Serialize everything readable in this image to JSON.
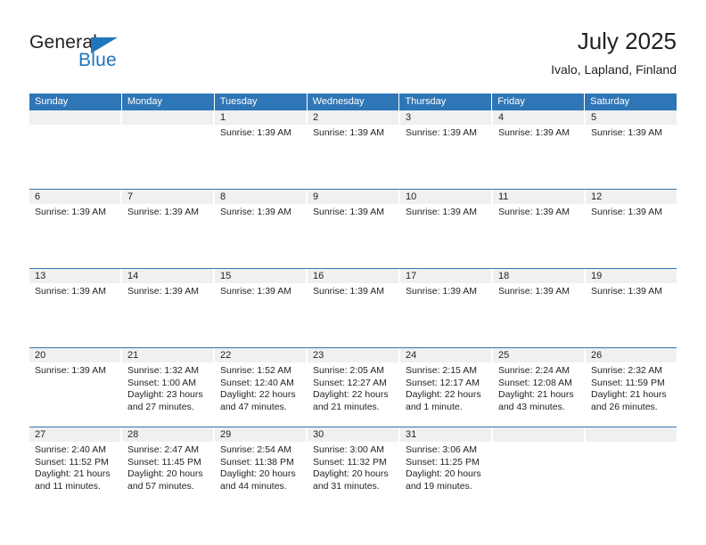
{
  "brand": {
    "name_part1": "General",
    "name_part2": "Blue",
    "triangle_color": "#1f76bc",
    "text_color": "#231f20"
  },
  "header": {
    "title": "July 2025",
    "subtitle": "Ivalo, Lapland, Finland",
    "header_bg": "#2f76b6",
    "daynum_bg": "#f0f0f0"
  },
  "weekdays": [
    "Sunday",
    "Monday",
    "Tuesday",
    "Wednesday",
    "Thursday",
    "Friday",
    "Saturday"
  ],
  "weeks": [
    {
      "days": [
        {
          "num": "",
          "lines": []
        },
        {
          "num": "",
          "lines": []
        },
        {
          "num": "1",
          "lines": [
            "Sunrise: 1:39 AM"
          ]
        },
        {
          "num": "2",
          "lines": [
            "Sunrise: 1:39 AM"
          ]
        },
        {
          "num": "3",
          "lines": [
            "Sunrise: 1:39 AM"
          ]
        },
        {
          "num": "4",
          "lines": [
            "Sunrise: 1:39 AM"
          ]
        },
        {
          "num": "5",
          "lines": [
            "Sunrise: 1:39 AM"
          ]
        }
      ]
    },
    {
      "days": [
        {
          "num": "6",
          "lines": [
            "Sunrise: 1:39 AM"
          ]
        },
        {
          "num": "7",
          "lines": [
            "Sunrise: 1:39 AM"
          ]
        },
        {
          "num": "8",
          "lines": [
            "Sunrise: 1:39 AM"
          ]
        },
        {
          "num": "9",
          "lines": [
            "Sunrise: 1:39 AM"
          ]
        },
        {
          "num": "10",
          "lines": [
            "Sunrise: 1:39 AM"
          ]
        },
        {
          "num": "11",
          "lines": [
            "Sunrise: 1:39 AM"
          ]
        },
        {
          "num": "12",
          "lines": [
            "Sunrise: 1:39 AM"
          ]
        }
      ]
    },
    {
      "days": [
        {
          "num": "13",
          "lines": [
            "Sunrise: 1:39 AM"
          ]
        },
        {
          "num": "14",
          "lines": [
            "Sunrise: 1:39 AM"
          ]
        },
        {
          "num": "15",
          "lines": [
            "Sunrise: 1:39 AM"
          ]
        },
        {
          "num": "16",
          "lines": [
            "Sunrise: 1:39 AM"
          ]
        },
        {
          "num": "17",
          "lines": [
            "Sunrise: 1:39 AM"
          ]
        },
        {
          "num": "18",
          "lines": [
            "Sunrise: 1:39 AM"
          ]
        },
        {
          "num": "19",
          "lines": [
            "Sunrise: 1:39 AM"
          ]
        }
      ]
    },
    {
      "days": [
        {
          "num": "20",
          "lines": [
            "Sunrise: 1:39 AM"
          ]
        },
        {
          "num": "21",
          "lines": [
            "Sunrise: 1:32 AM",
            "Sunset: 1:00 AM",
            "Daylight: 23 hours",
            "and 27 minutes."
          ]
        },
        {
          "num": "22",
          "lines": [
            "Sunrise: 1:52 AM",
            "Sunset: 12:40 AM",
            "Daylight: 22 hours",
            "and 47 minutes."
          ]
        },
        {
          "num": "23",
          "lines": [
            "Sunrise: 2:05 AM",
            "Sunset: 12:27 AM",
            "Daylight: 22 hours",
            "and 21 minutes."
          ]
        },
        {
          "num": "24",
          "lines": [
            "Sunrise: 2:15 AM",
            "Sunset: 12:17 AM",
            "Daylight: 22 hours",
            "and 1 minute."
          ]
        },
        {
          "num": "25",
          "lines": [
            "Sunrise: 2:24 AM",
            "Sunset: 12:08 AM",
            "Daylight: 21 hours",
            "and 43 minutes."
          ]
        },
        {
          "num": "26",
          "lines": [
            "Sunrise: 2:32 AM",
            "Sunset: 11:59 PM",
            "Daylight: 21 hours",
            "and 26 minutes."
          ]
        }
      ]
    },
    {
      "days": [
        {
          "num": "27",
          "lines": [
            "Sunrise: 2:40 AM",
            "Sunset: 11:52 PM",
            "Daylight: 21 hours",
            "and 11 minutes."
          ]
        },
        {
          "num": "28",
          "lines": [
            "Sunrise: 2:47 AM",
            "Sunset: 11:45 PM",
            "Daylight: 20 hours",
            "and 57 minutes."
          ]
        },
        {
          "num": "29",
          "lines": [
            "Sunrise: 2:54 AM",
            "Sunset: 11:38 PM",
            "Daylight: 20 hours",
            "and 44 minutes."
          ]
        },
        {
          "num": "30",
          "lines": [
            "Sunrise: 3:00 AM",
            "Sunset: 11:32 PM",
            "Daylight: 20 hours",
            "and 31 minutes."
          ]
        },
        {
          "num": "31",
          "lines": [
            "Sunrise: 3:06 AM",
            "Sunset: 11:25 PM",
            "Daylight: 20 hours",
            "and 19 minutes."
          ]
        },
        {
          "num": "",
          "lines": []
        },
        {
          "num": "",
          "lines": []
        }
      ]
    }
  ]
}
